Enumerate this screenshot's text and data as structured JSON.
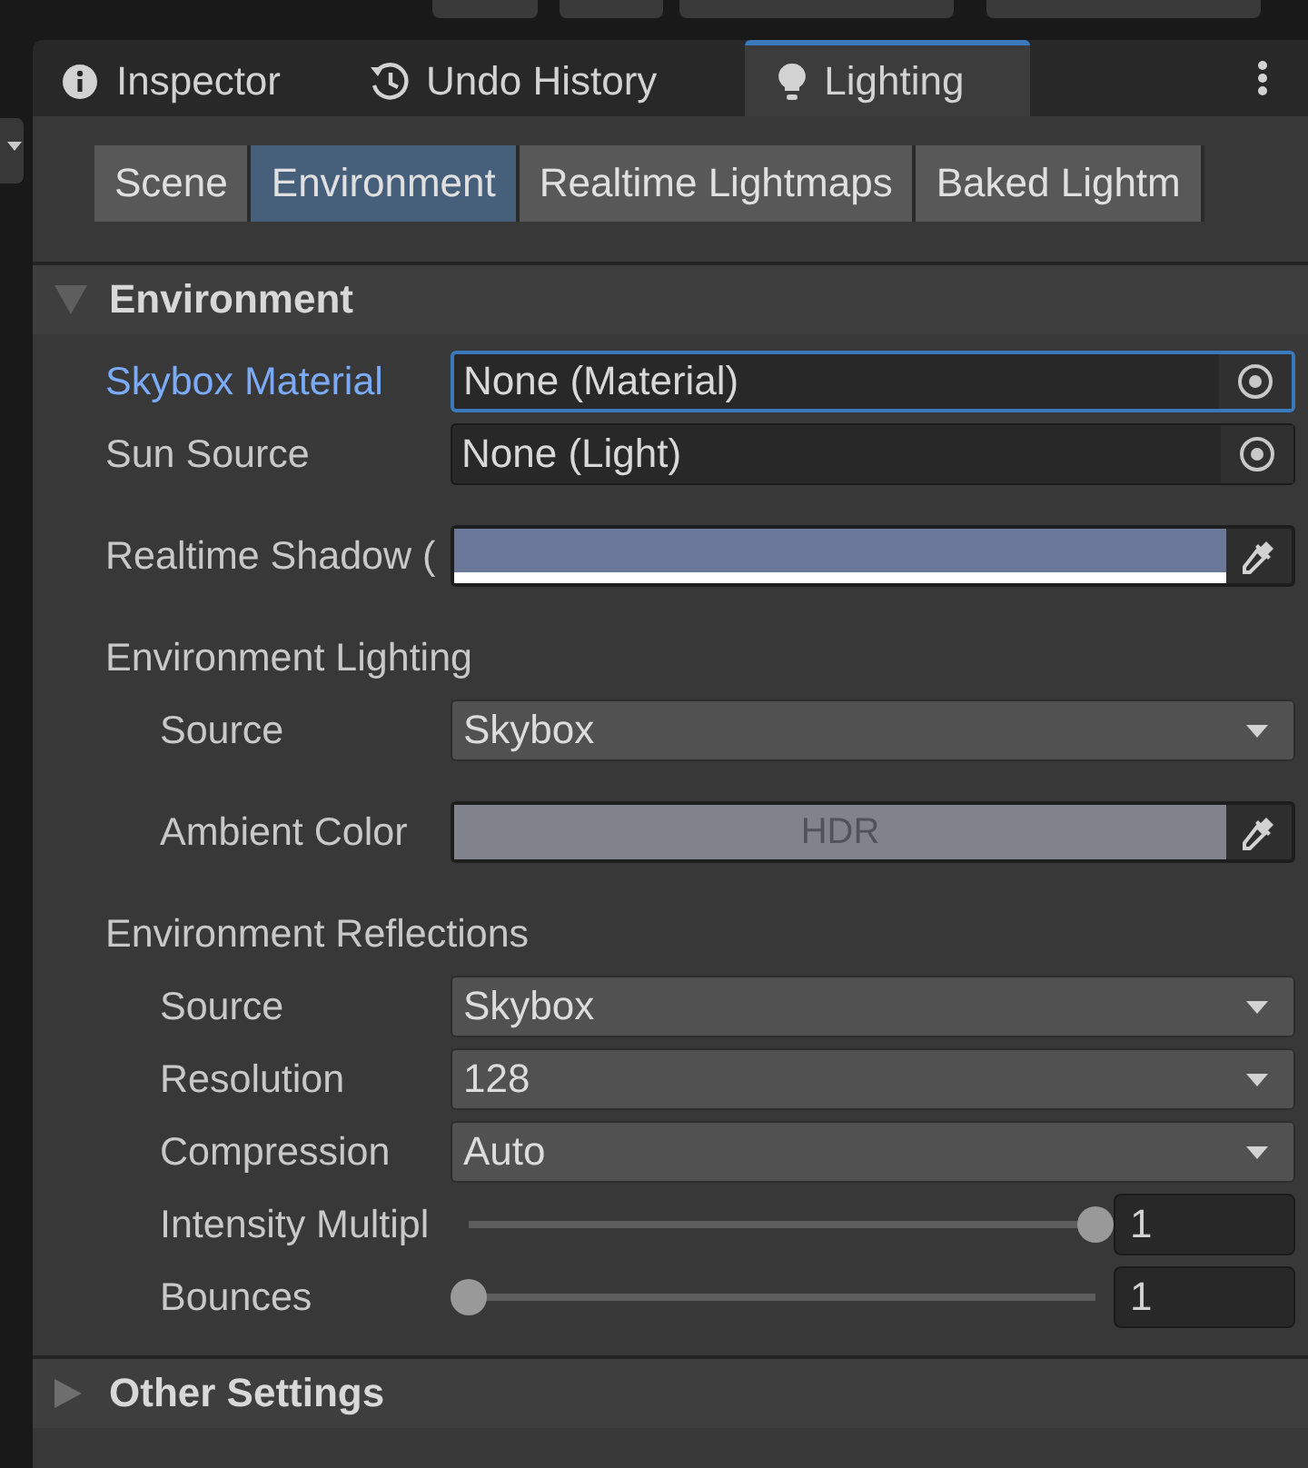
{
  "tabs": [
    {
      "label": "Inspector",
      "selected": false
    },
    {
      "label": "Undo History",
      "selected": false
    },
    {
      "label": "Lighting",
      "selected": true
    }
  ],
  "subtabs": [
    {
      "label": "Scene",
      "selected": false
    },
    {
      "label": "Environment",
      "selected": true
    },
    {
      "label": "Realtime Lightmaps",
      "selected": false
    },
    {
      "label": "Baked Lightm",
      "selected": false
    }
  ],
  "sections": [
    {
      "title": "Environment",
      "expanded": true,
      "rows": [
        {
          "kind": "object",
          "label": "Skybox Material",
          "value": "None (Material)",
          "focused": true
        },
        {
          "kind": "object",
          "label": "Sun Source",
          "value": "None (Light)",
          "focused": false
        },
        {
          "kind": "color",
          "label": "Realtime Shadow (",
          "color": "#6b7899"
        },
        {
          "kind": "heading",
          "label": "Environment Lighting",
          "children": [
            {
              "kind": "dropdown",
              "label": "Source",
              "value": "Skybox"
            },
            {
              "kind": "color",
              "label": "Ambient Color",
              "color": "#80838c",
              "badge": "HDR"
            }
          ]
        },
        {
          "kind": "heading",
          "label": "Environment Reflections",
          "children": [
            {
              "kind": "dropdown",
              "label": "Source",
              "value": "Skybox"
            },
            {
              "kind": "dropdown",
              "label": "Resolution",
              "value": "128"
            },
            {
              "kind": "dropdown",
              "label": "Compression",
              "value": "Auto"
            },
            {
              "kind": "slider",
              "label": "Intensity Multipl",
              "level": 1,
              "value": "1"
            },
            {
              "kind": "slider",
              "label": "Bounces",
              "level": 0,
              "value": "1"
            }
          ]
        }
      ]
    },
    {
      "title": "Other Settings",
      "expanded": false
    }
  ]
}
